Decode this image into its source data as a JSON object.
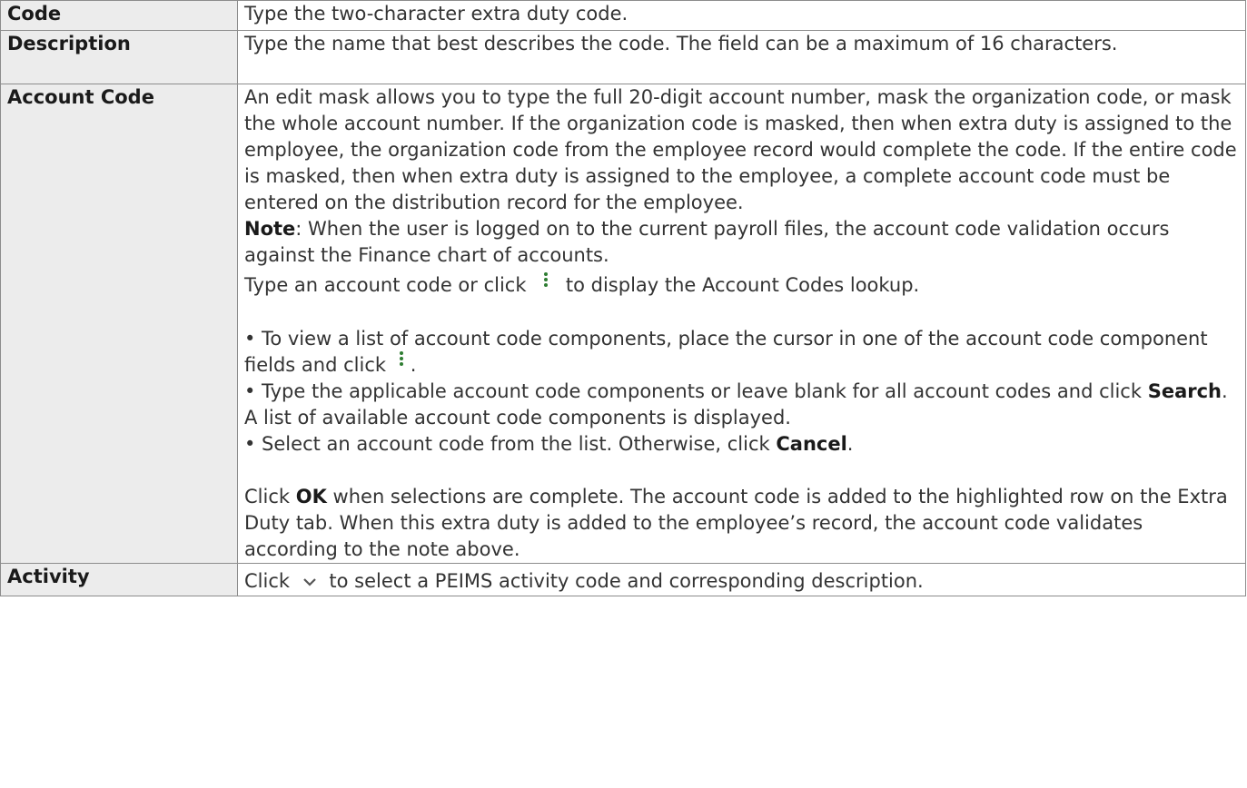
{
  "rows": [
    {
      "label": "Code",
      "text": "Type the two-character extra duty code."
    },
    {
      "label": "Description",
      "text": "Type the name that best describes the code. The field can be a maximum of 16 characters."
    },
    {
      "label": "Account Code",
      "p1": "An edit mask allows you to type the full 20-digit account number, mask the organization code, or mask the whole account number. If the organization code is masked, then when extra duty is assigned to the employee, the organization code from the employee record would complete the code. If the entire code is masked, then when extra duty is assigned to the employee, a complete account code must be entered on the distribution record for the employee.",
      "note_label": "Note",
      "note_text": ": When the user is logged on to the current payroll files, the account code validation occurs against the Finance chart of accounts.",
      "lookup_pre": "Type an account code or click",
      "lookup_post": "to display the Account Codes lookup.",
      "b1": "• To view a list of account code components, place the cursor in one of the account code component fields and click",
      "b1_end": ".",
      "b2_pre": "• Type the applicable account code components or leave blank for all account codes and click",
      "b2_bold": "Search",
      "b2_post": ". A list of available account code components is displayed.",
      "b3_pre": "• Select an account code from the list. Otherwise, click",
      "b3_bold": "Cancel",
      "b3_post": ".",
      "ok_pre": "Click",
      "ok_bold": "OK",
      "ok_post": "when selections are complete. The account code is added to the highlighted row on the Extra Duty tab. When this extra duty is added to the employee’s record, the account code validates according to the note above."
    },
    {
      "label": "Activity",
      "pre": "Click",
      "post": "to select a PEIMS activity code and corresponding description."
    }
  ],
  "icons": {
    "lookup": "vertical-dots-icon",
    "dropdown": "chevron-down-icon",
    "icon_color": "#2e7d32",
    "chevron_color": "#555555"
  }
}
